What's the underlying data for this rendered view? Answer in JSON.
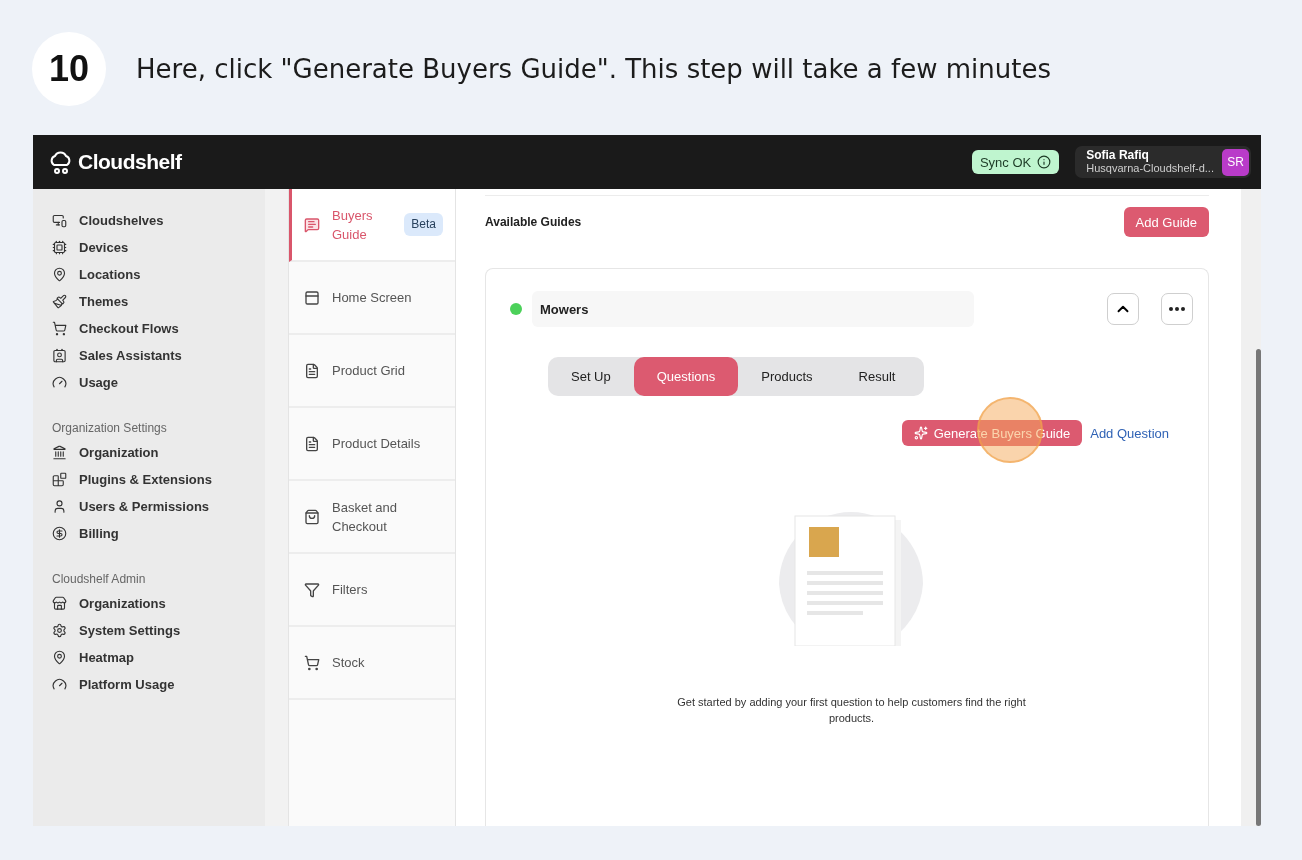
{
  "step": {
    "number": "10",
    "instruction": "Here, click \"Generate Buyers Guide\". This step will take a few minutes"
  },
  "app": {
    "brand": "Cloudshelf",
    "sync": "Sync OK",
    "user": {
      "name": "Sofia Rafiq",
      "org": "Husqvarna-Cloudshelf-d...",
      "initials": "SR"
    }
  },
  "sidebar": {
    "sections": [
      {
        "items": [
          "Cloudshelves",
          "Devices",
          "Locations",
          "Themes",
          "Checkout Flows",
          "Sales Assistants",
          "Usage"
        ]
      },
      {
        "title": "Organization Settings",
        "items": [
          "Organization",
          "Plugins & Extensions",
          "Users & Permissions",
          "Billing"
        ]
      },
      {
        "title": "Cloudshelf Admin",
        "items": [
          "Organizations",
          "System Settings",
          "Heatmap",
          "Platform Usage"
        ]
      }
    ]
  },
  "settings_nav": [
    {
      "label": "Buyers Guide",
      "badge": "Beta",
      "selected": true
    },
    {
      "label": "Home Screen",
      "selected": false
    },
    {
      "label": "Product Grid",
      "selected": false
    },
    {
      "label": "Product Details",
      "selected": false
    },
    {
      "label": "Basket and Checkout",
      "selected": false
    },
    {
      "label": "Filters",
      "selected": false
    },
    {
      "label": "Stock",
      "selected": false
    }
  ],
  "main": {
    "heading": "Available Guides",
    "add_button": "Add Guide",
    "guide": {
      "name": "Mowers",
      "active": true,
      "expanded": true,
      "tabs": [
        {
          "label": "Set Up",
          "selected": false
        },
        {
          "label": "Questions",
          "selected": true
        },
        {
          "label": "Products",
          "selected": false
        },
        {
          "label": "Result",
          "selected": false
        }
      ],
      "generate_button": "Generate Buyers Guide",
      "add_question": "Add Question",
      "empty_text": "Get started by adding your first question to help customers find the right products."
    }
  }
}
